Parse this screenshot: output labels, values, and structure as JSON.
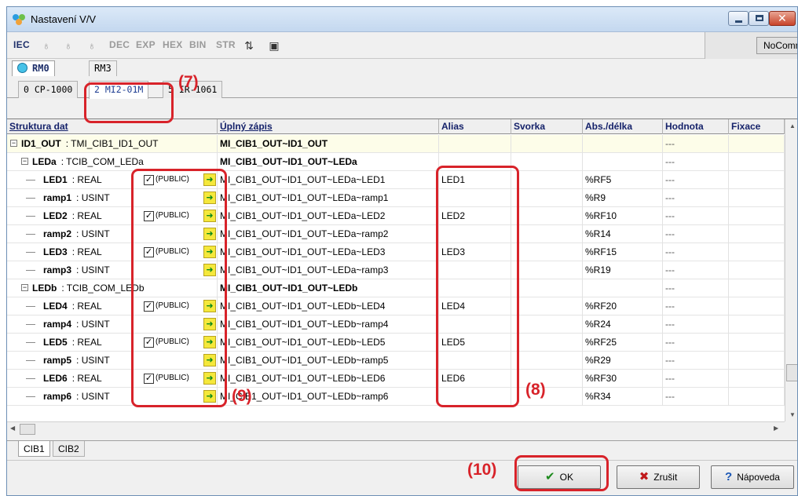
{
  "window": {
    "title": "Nastavení V/V",
    "accent": "#d8232a"
  },
  "toolbar": {
    "items": [
      "IEC",
      "DEC",
      "EXP",
      "HEX",
      "BIN",
      "STR"
    ],
    "status": "NoComm"
  },
  "rm_tabs": [
    "RM0",
    "RM3"
  ],
  "module_tabs": [
    "0 CP-1000",
    "2 MI2-01M",
    "5 IR-1061"
  ],
  "columns": [
    "Struktura dat",
    "Úplný zápis",
    "Alias",
    "Svorka",
    "Abs./délka",
    "Hodnota",
    "Fixace"
  ],
  "rows": [
    {
      "name": "ID1_OUT",
      "type": ": TMI_CIB1_ID1_OUT",
      "full": "MI_CIB1_OUT~ID1_OUT",
      "alias": "",
      "abs": "",
      "value": "---"
    },
    {
      "name": "LEDa",
      "type": ": TCIB_COM_LEDa",
      "full": "MI_CIB1_OUT~ID1_OUT~LEDa",
      "alias": "",
      "abs": "",
      "value": "---"
    },
    {
      "name": "LED1",
      "type": ": REAL",
      "public": "(PUBLIC)",
      "full": "MI_CIB1_OUT~ID1_OUT~LEDa~LED1",
      "alias": "LED1",
      "abs": "%RF5",
      "value": "---"
    },
    {
      "name": "ramp1",
      "type": ": USINT",
      "full": "MI_CIB1_OUT~ID1_OUT~LEDa~ramp1",
      "alias": "",
      "abs": "%R9",
      "value": "---"
    },
    {
      "name": "LED2",
      "type": ": REAL",
      "public": "(PUBLIC)",
      "full": "MI_CIB1_OUT~ID1_OUT~LEDa~LED2",
      "alias": "LED2",
      "abs": "%RF10",
      "value": "---"
    },
    {
      "name": "ramp2",
      "type": ": USINT",
      "full": "MI_CIB1_OUT~ID1_OUT~LEDa~ramp2",
      "alias": "",
      "abs": "%R14",
      "value": "---"
    },
    {
      "name": "LED3",
      "type": ": REAL",
      "public": "(PUBLIC)",
      "full": "MI_CIB1_OUT~ID1_OUT~LEDa~LED3",
      "alias": "LED3",
      "abs": "%RF15",
      "value": "---"
    },
    {
      "name": "ramp3",
      "type": ": USINT",
      "full": "MI_CIB1_OUT~ID1_OUT~LEDa~ramp3",
      "alias": "",
      "abs": "%R19",
      "value": "---"
    },
    {
      "name": "LEDb",
      "type": ": TCIB_COM_LEDb",
      "full": "MI_CIB1_OUT~ID1_OUT~LEDb",
      "alias": "",
      "abs": "",
      "value": "---"
    },
    {
      "name": "LED4",
      "type": ": REAL",
      "public": "(PUBLIC)",
      "full": "MI_CIB1_OUT~ID1_OUT~LEDb~LED4",
      "alias": "LED4",
      "abs": "%RF20",
      "value": "---"
    },
    {
      "name": "ramp4",
      "type": ": USINT",
      "full": "MI_CIB1_OUT~ID1_OUT~LEDb~ramp4",
      "alias": "",
      "abs": "%R24",
      "value": "---"
    },
    {
      "name": "LED5",
      "type": ": REAL",
      "public": "(PUBLIC)",
      "full": "MI_CIB1_OUT~ID1_OUT~LEDb~LED5",
      "alias": "LED5",
      "abs": "%RF25",
      "value": "---"
    },
    {
      "name": "ramp5",
      "type": ": USINT",
      "full": "MI_CIB1_OUT~ID1_OUT~LEDb~ramp5",
      "alias": "",
      "abs": "%R29",
      "value": "---"
    },
    {
      "name": "LED6",
      "type": ": REAL",
      "public": "(PUBLIC)",
      "full": "MI_CIB1_OUT~ID1_OUT~LEDb~LED6",
      "alias": "LED6",
      "abs": "%RF30",
      "value": "---"
    },
    {
      "name": "ramp6",
      "type": ": USINT",
      "full": "MI_CIB1_OUT~ID1_OUT~LEDb~ramp6",
      "alias": "",
      "abs": "%R34",
      "value": "---"
    }
  ],
  "bottom_tabs": [
    "CIB1",
    "CIB2"
  ],
  "buttons": {
    "ok": "OK",
    "cancel": "Zrušit",
    "help": "Nápoveda"
  },
  "annotations": {
    "a7": "(7)",
    "a8": "(8)",
    "a9": "(9)",
    "a10": "(10)"
  }
}
